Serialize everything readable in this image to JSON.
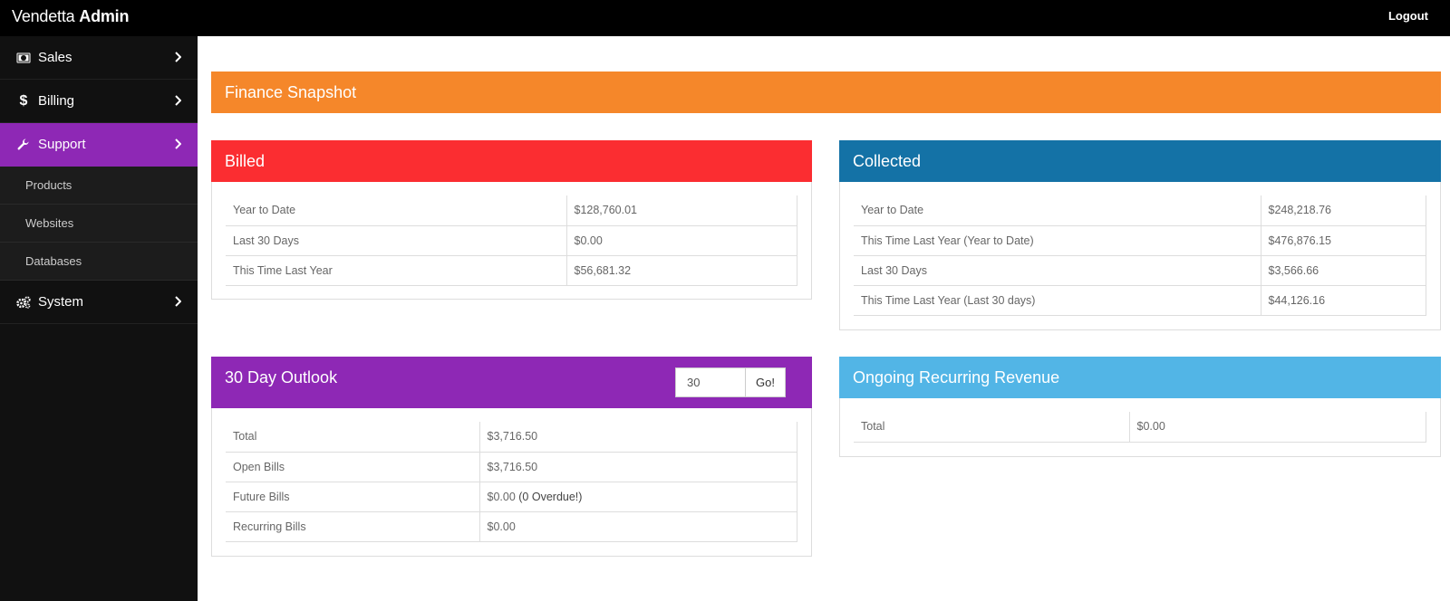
{
  "app": {
    "brand_light": "Vendetta",
    "brand_bold": "Admin",
    "logout_label": "Logout"
  },
  "sidebar": {
    "items": [
      {
        "label": "Sales",
        "icon": "money-icon"
      },
      {
        "label": "Billing",
        "icon": "dollar-icon"
      },
      {
        "label": "Support",
        "icon": "wrench-icon",
        "active": true,
        "children": [
          "Products",
          "Websites",
          "Databases"
        ]
      },
      {
        "label": "System",
        "icon": "gears-icon"
      }
    ]
  },
  "main": {
    "banner": {
      "title": "Finance Snapshot",
      "color": "#f5872a"
    },
    "billed": {
      "title": "Billed",
      "color": "#fb2d31",
      "rows": [
        [
          "Year to Date",
          "$128,760.01"
        ],
        [
          "Last 30 Days",
          "$0.00"
        ],
        [
          "This Time Last Year",
          "$56,681.32"
        ]
      ]
    },
    "collected": {
      "title": "Collected",
      "color": "#1472a6",
      "rows": [
        [
          "Year to Date",
          "$248,218.76"
        ],
        [
          "This Time Last Year (Year to Date)",
          "$476,876.15"
        ],
        [
          "Last 30 Days",
          "$3,566.66"
        ],
        [
          "This Time Last Year (Last 30 days)",
          "$44,126.16"
        ]
      ]
    },
    "outlook": {
      "title": "30 Day Outlook",
      "color": "#8e28b5",
      "days_value": "30",
      "go_label": "Go!",
      "rows": [
        [
          "Total",
          "$3,716.50",
          ""
        ],
        [
          "Open Bills",
          "$3,716.50",
          ""
        ],
        [
          "Future Bills",
          "$0.00",
          "(0 Overdue!)"
        ],
        [
          "Recurring Bills",
          "$0.00",
          ""
        ]
      ]
    },
    "recurring": {
      "title": "Ongoing Recurring Revenue",
      "color": "#52b5e6",
      "rows": [
        [
          "Total",
          "$0.00"
        ]
      ]
    }
  }
}
